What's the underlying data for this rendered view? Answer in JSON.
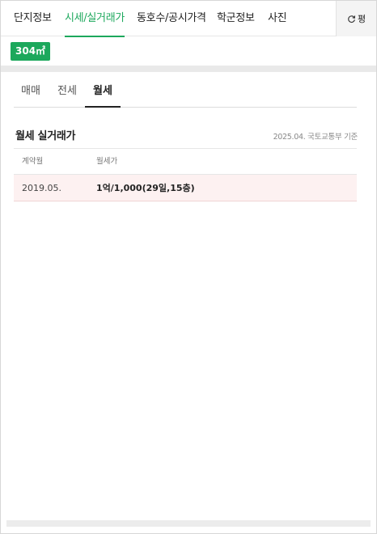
{
  "top_tabs": [
    {
      "label": "단지정보",
      "active": false
    },
    {
      "label": "시세/실거래가",
      "active": true
    },
    {
      "label": "동호수/공시가격",
      "active": false
    },
    {
      "label": "학군정보",
      "active": false
    },
    {
      "label": "사진",
      "active": false
    }
  ],
  "unit_toggle": {
    "icon": "refresh-icon",
    "label": "평"
  },
  "area_badge": "304㎡",
  "sub_tabs": [
    {
      "label": "매매",
      "active": false
    },
    {
      "label": "전세",
      "active": false
    },
    {
      "label": "월세",
      "active": true
    }
  ],
  "section": {
    "title": "월세 실거래가",
    "reference": "2025.04. 국토교통부 기준"
  },
  "table": {
    "headers": [
      "계약월",
      "월세가"
    ],
    "rows": [
      {
        "date": "2019.05.",
        "price": "1억/1,000(29일,15층)"
      }
    ]
  },
  "colors": {
    "accent": "#1ca85c",
    "row_highlight": "#fdf1f1"
  }
}
